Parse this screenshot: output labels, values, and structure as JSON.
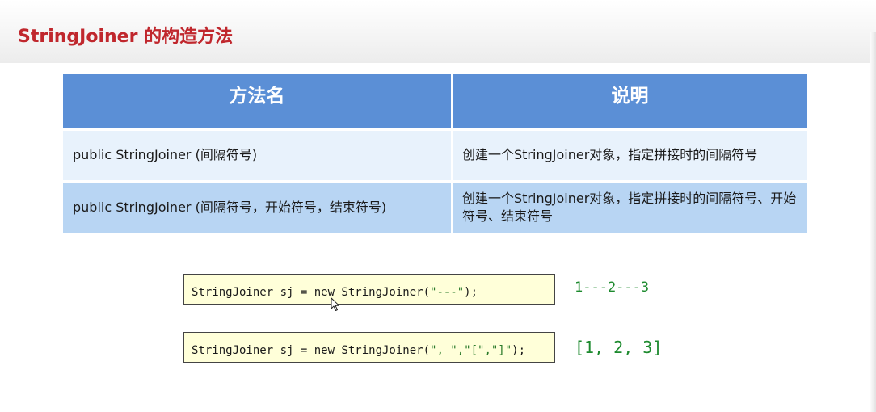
{
  "slide": {
    "title": "StringJoiner 的构造方法"
  },
  "table": {
    "headers": [
      "方法名",
      "说明"
    ],
    "rows": [
      {
        "method": "public StringJoiner (间隔符号)",
        "description": "创建一个StringJoiner对象，指定拼接时的间隔符号"
      },
      {
        "method": "public StringJoiner (间隔符号，开始符号，结束符号)",
        "description": "创建一个StringJoiner对象，指定拼接时的间隔符号、开始符号、结束符号"
      }
    ]
  },
  "examples": [
    {
      "code_prefix": "StringJoiner sj = new StringJoiner(",
      "code_args": "\"---\"",
      "code_suffix": ");",
      "result": "1---2---3"
    },
    {
      "code_prefix": "StringJoiner sj = new StringJoiner(",
      "code_args": "\", \",\"[\",\"]\"",
      "code_suffix": ");",
      "result": "[1, 2, 3]"
    }
  ],
  "colors": {
    "title": "#c0272d",
    "table_header": "#5b8fd6",
    "row_light": "#e8f2fc",
    "row_dark": "#b8d5f3",
    "code_background": "#ffffd9",
    "result_text": "#1d8a2e"
  },
  "icons": {
    "cursor": "mouse-pointer-icon"
  }
}
